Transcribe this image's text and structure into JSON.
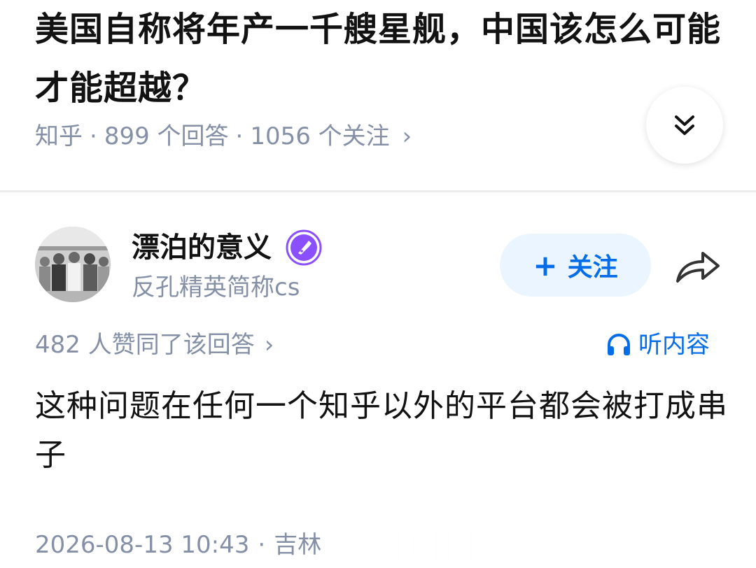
{
  "question": {
    "title": "美国自称将年产一千艘星舰，中国该怎么可能才能超越？",
    "source": "知乎",
    "answers_count": "899 个回答",
    "followers_count": "1056 个关注",
    "separator": "·",
    "chevron": "›",
    "collapse_icon": "double-chevron-down-icon"
  },
  "author": {
    "name": "漂泊的意义",
    "bio": "反孔精英简称cs",
    "follow_plus": "+",
    "follow_label": "关注",
    "badge_icon": "pen-badge-icon",
    "share_icon": "share-icon"
  },
  "answer": {
    "votes": "482 人赞同了该回答",
    "chevron": "›",
    "listen_label": "听内容",
    "listen_icon": "headphones-icon",
    "content": "这种问题在任何一个知乎以外的平台都会被打成串子",
    "timestamp": "2026-08-13 10:43",
    "separator": "·",
    "location": "吉林"
  },
  "colors": {
    "primary_blue": "#056de8",
    "follow_bg": "#ebf5ff",
    "meta_gray": "#8590a6",
    "text": "#121212",
    "badge_purple": "#8a4fff"
  }
}
